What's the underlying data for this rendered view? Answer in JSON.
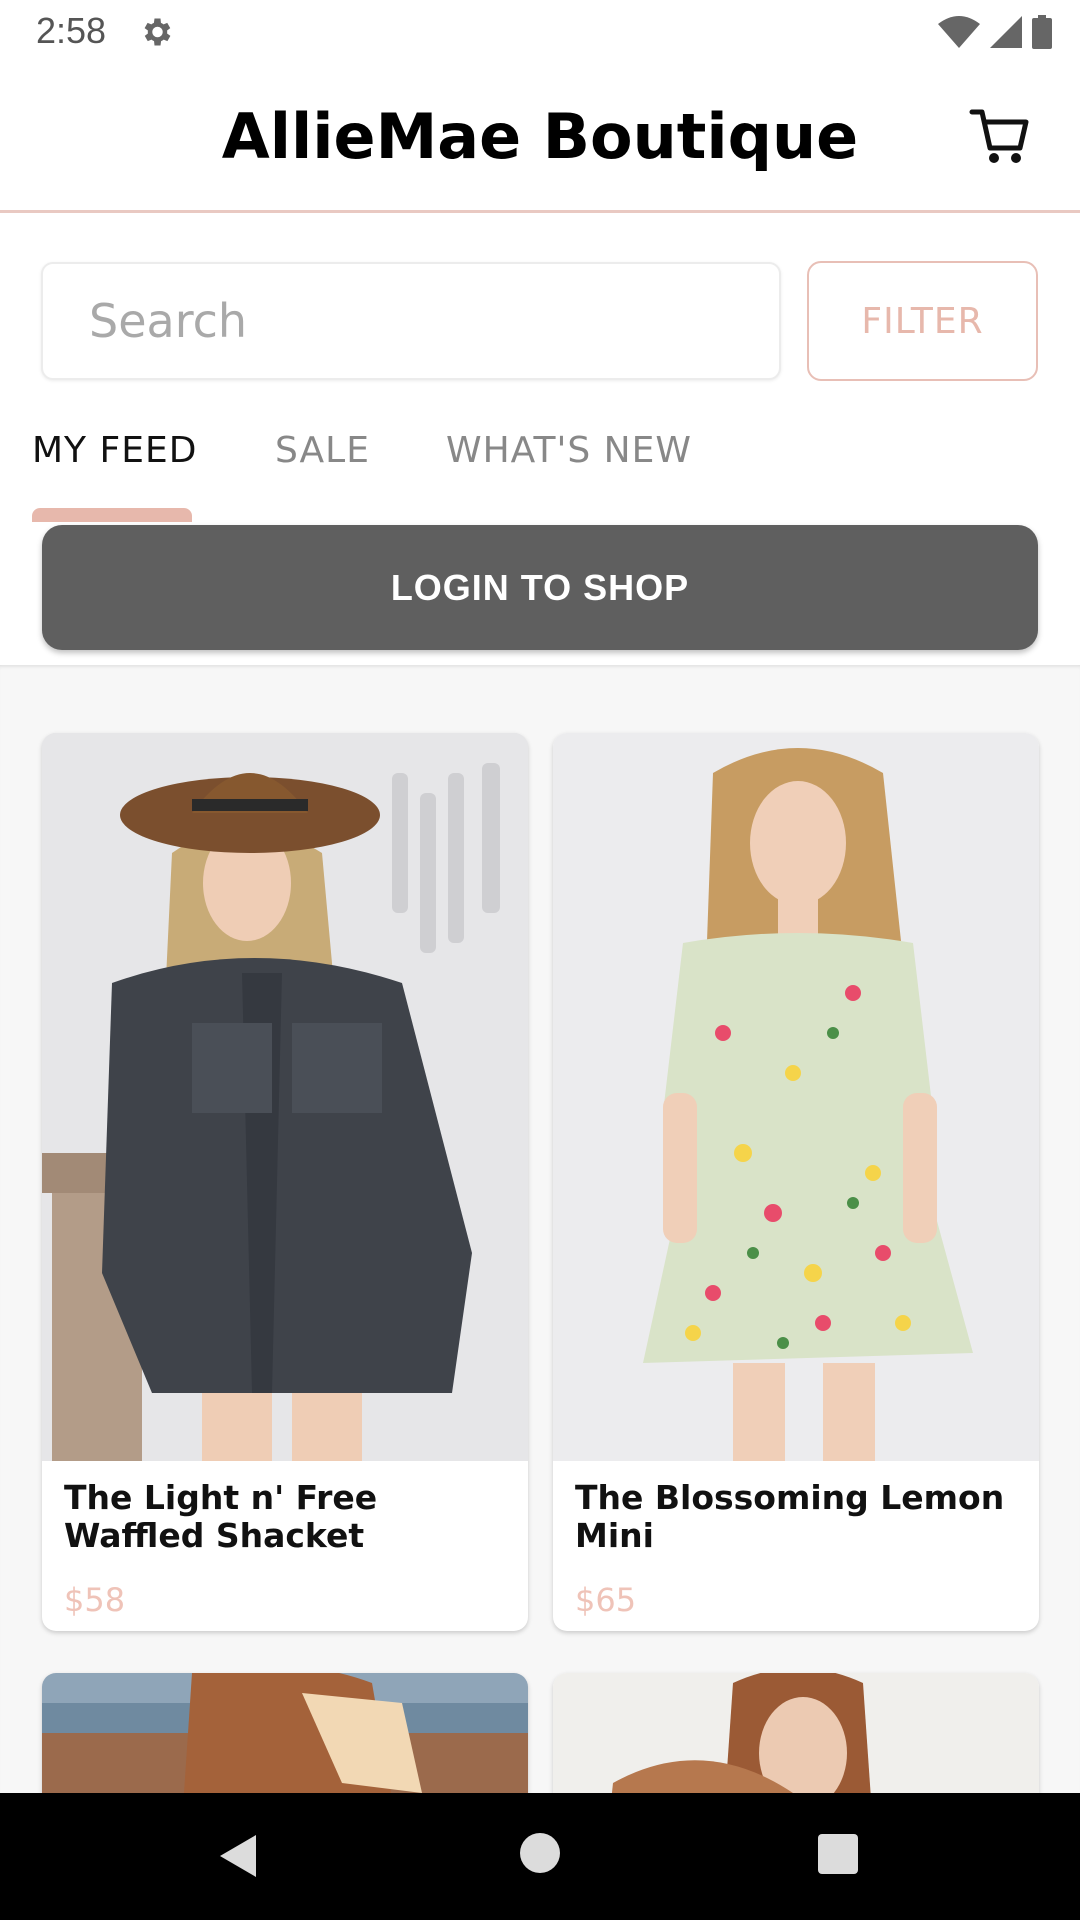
{
  "status_bar": {
    "time": "2:58",
    "icons": [
      "settings-icon",
      "wifi-icon",
      "signal-icon",
      "battery-icon"
    ]
  },
  "header": {
    "title": "AllieMae Boutique",
    "cart_icon": "cart-icon"
  },
  "search": {
    "placeholder": "Search",
    "value": ""
  },
  "filter": {
    "label": "FILTER"
  },
  "tabs": [
    {
      "label": "MY FEED",
      "active": true
    },
    {
      "label": "SALE",
      "active": false
    },
    {
      "label": "WHAT'S NEW",
      "active": false
    }
  ],
  "login_button": {
    "label": "LOGIN TO SHOP"
  },
  "products": [
    {
      "name": "The Light n' Free Waffled Shacket",
      "price": "$58"
    },
    {
      "name": "The Blossoming Lemon Mini",
      "price": "$65"
    }
  ],
  "colors": {
    "accent": "#e7b8ac",
    "price": "#efc3b8",
    "login_bg": "#5f5f5f",
    "header_border": "#e9c9c2"
  },
  "nav_bar": {
    "icons": [
      "back-icon",
      "home-icon",
      "recents-icon"
    ]
  }
}
